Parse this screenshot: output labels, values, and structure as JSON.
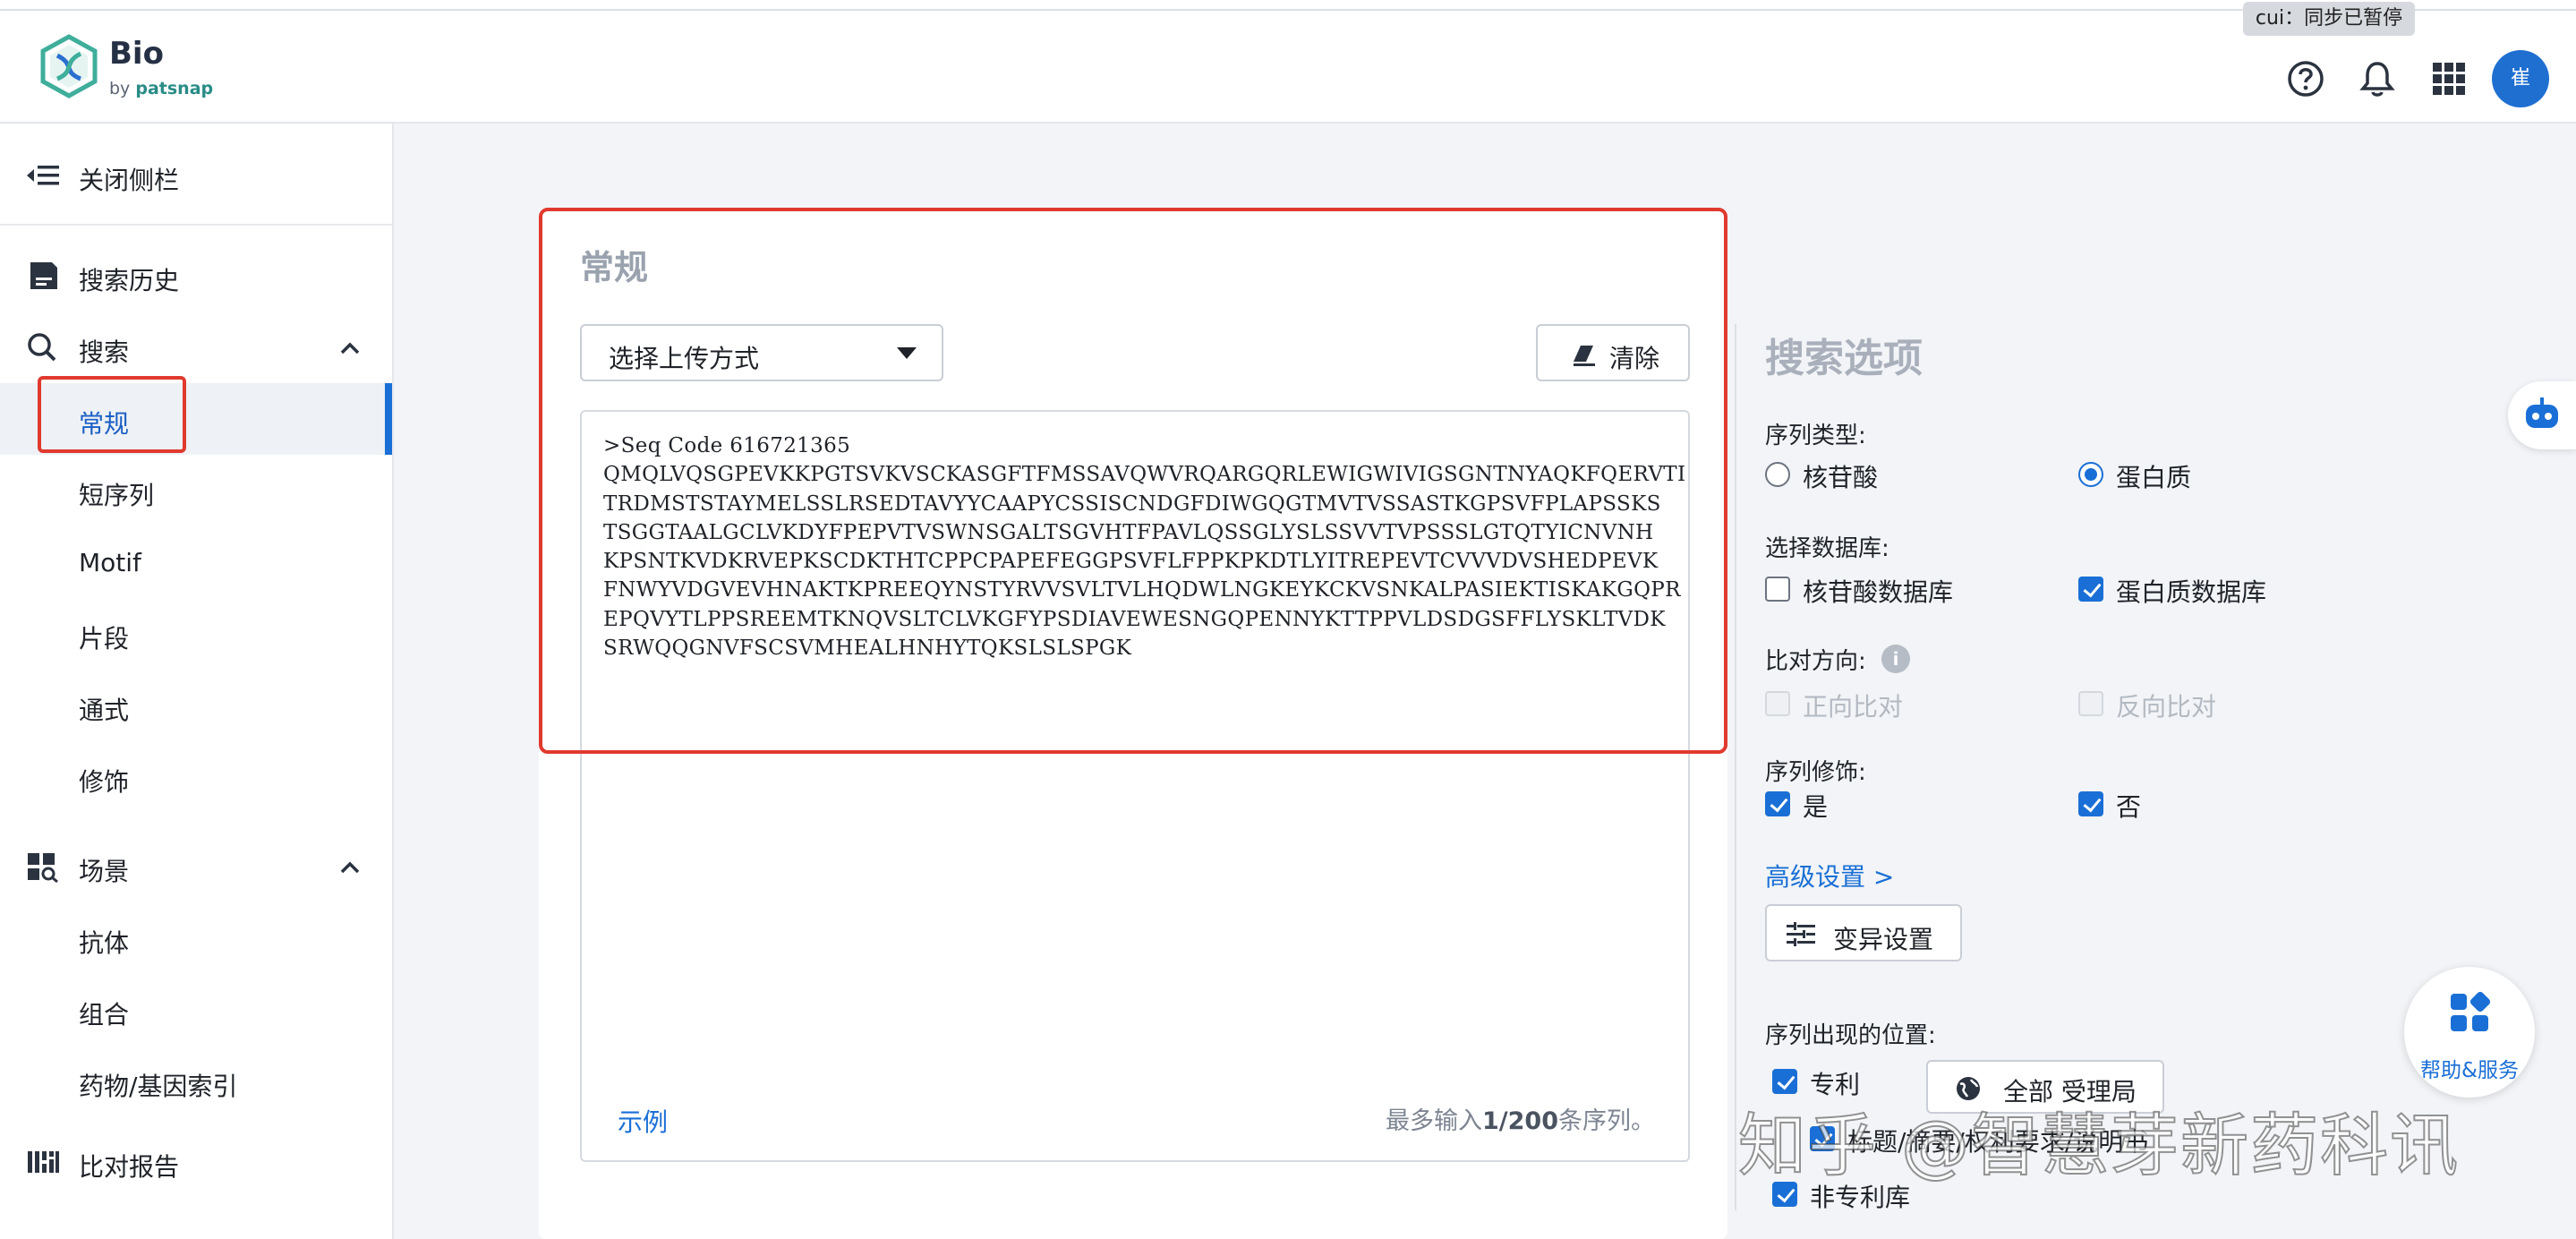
{
  "header": {
    "app_name": "Bio",
    "app_by": "by",
    "app_brand": "patsnap",
    "sync_tooltip": "cui：同步已暂停",
    "avatar_text": "崔",
    "icons": [
      "help-icon",
      "bell-icon",
      "apps-grid-icon"
    ]
  },
  "sidebar": {
    "close_label": "关闭侧栏",
    "history_label": "搜索历史",
    "search_label": "搜索",
    "search_items": [
      "常规",
      "短序列",
      "Motif",
      "片段",
      "通式",
      "修饰"
    ],
    "active_item": "常规",
    "scene_label": "场景",
    "scene_items": [
      "抗体",
      "组合",
      "药物/基因索引"
    ],
    "report_label": "比对报告"
  },
  "main": {
    "title": "常规",
    "upload_select": "选择上传方式",
    "clear_label": "清除",
    "sequence_text": ">Seq Code 616721365\nQMQLVQSGPEVKKPGTSVKVSCKASGFTFMSSAVQWVRQARGQRLEWIGWIVIGSGNTNYAQKFQERVTI\nTRDMSTSTAYMELSSLRSEDTAVYYCAAPYCSSISCNDGFDIWGQGTMVTVSSASTKGPSVFPLAPSSKS\nTSGGTAALGCLVKDYFPEPVTVSWNSGALTSGVHTFPAVLQSSGLYSLSSVVTVPSSSLGTQTYICNVNH\nKPSNTKVDKRVEPKSCDKTHTCPPCPAPEFEGGPSVFLFPPKPKDTLYITREPEVTCVVVDVSHEDPEVK\nFNWYVDGVEVHNAKTKPREEQYNSTYRVVSVLTVLHQDWLNGKEYKCKVSNKALPASIEKTISKAKGQPR\nEPQVYTLPPSREEMTKNQVSLTCLVKGFYPSDIAVEWESNGQPENNYKTTPPVLDSDGSFFLYSKLTVDK\nSRWQQGNVFSCSVMHEALHNHYTQKSLSLSPGK",
    "example_link": "示例",
    "max_prefix": "最多输入",
    "max_count": "1/200",
    "max_suffix": "条序列。"
  },
  "options": {
    "title": "搜索选项",
    "seq_type_label": "序列类型:",
    "seq_types": [
      "核苷酸",
      "蛋白质"
    ],
    "seq_type_selected": "蛋白质",
    "db_label": "选择数据库:",
    "databases": [
      {
        "label": "核苷酸数据库",
        "checked": false
      },
      {
        "label": "蛋白质数据库",
        "checked": true
      }
    ],
    "direction_label": "比对方向:",
    "info_glyph": "i",
    "directions": [
      {
        "label": "正向比对",
        "checked": false,
        "disabled": true
      },
      {
        "label": "反向比对",
        "checked": false,
        "disabled": true
      }
    ],
    "mod_label": "序列修饰:",
    "mods": [
      {
        "label": "是",
        "checked": true
      },
      {
        "label": "否",
        "checked": true
      }
    ],
    "advanced_link": "高级设置 >",
    "variant_button": "变异设置",
    "location_label": "序列出现的位置:",
    "patent_label": "专利",
    "patent_checked": true,
    "authority_button": "全部 受理局",
    "sub_locations_text": "标题/摘要/权利要求/说明书",
    "nonpatent_label": "非专利库",
    "nonpatent_checked": true
  },
  "floating": {
    "help_label": "帮助&服务",
    "watermark": "知乎 @智慧芽新药科讯"
  },
  "colors": {
    "accent": "#1a6fd6",
    "highlight_box": "#e03a2e",
    "brand_teal": "#2a8c87"
  }
}
